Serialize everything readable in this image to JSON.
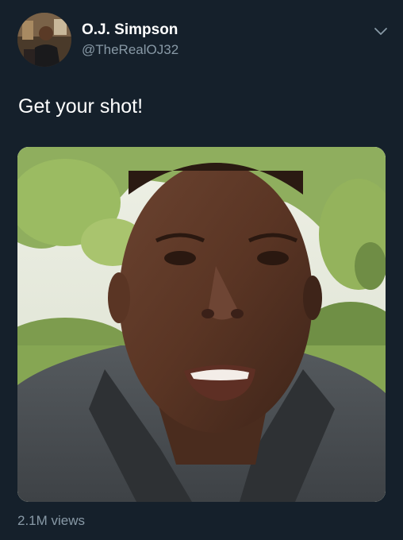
{
  "tweet": {
    "author_name": "O.J. Simpson",
    "author_handle": "@TheRealOJ32",
    "text": "Get your shot!",
    "view_count": "2.1M views"
  },
  "icons": {
    "menu": "chevron-down-icon"
  },
  "colors": {
    "background": "#15202b",
    "primary_text": "#ffffff",
    "secondary_text": "#8899a6"
  }
}
